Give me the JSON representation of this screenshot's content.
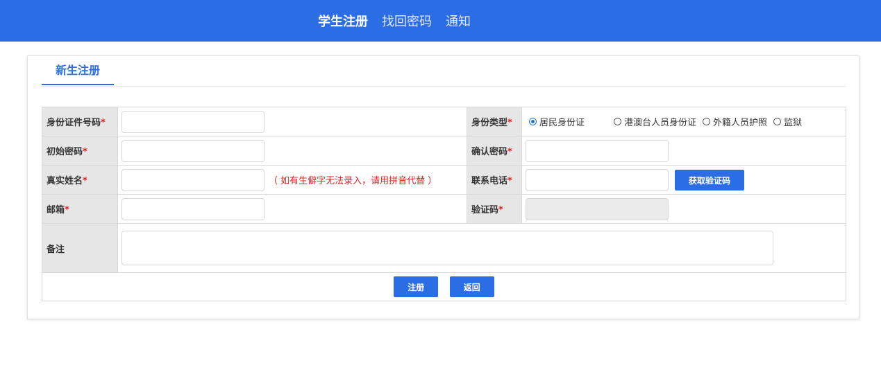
{
  "nav": {
    "items": [
      {
        "label": "学生注册",
        "active": true
      },
      {
        "label": "找回密码",
        "active": false
      },
      {
        "label": "通知",
        "active": false
      }
    ]
  },
  "card": {
    "tab_label": "新生注册"
  },
  "form": {
    "required_mark": "*",
    "id_number": {
      "label": "身份证件号码",
      "value": ""
    },
    "id_type": {
      "label": "身份类型",
      "options": [
        "居民身份证",
        "港澳台人员身份证",
        "外籍人员护照",
        "监狱"
      ],
      "selected": "居民身份证"
    },
    "initial_password": {
      "label": "初始密码",
      "value": ""
    },
    "confirm_password": {
      "label": "确认密码",
      "value": ""
    },
    "real_name": {
      "label": "真实姓名",
      "value": "",
      "hint": "（ 如有生僻字无法录入，请用拼音代替 ）"
    },
    "phone": {
      "label": "联系电话",
      "value": "",
      "get_code_button": "获取验证码"
    },
    "email": {
      "label": "邮箱",
      "value": ""
    },
    "verify_code": {
      "label": "验证码",
      "value": "",
      "disabled": true
    },
    "remark": {
      "label": "备注",
      "value": ""
    },
    "submit_button": "注册",
    "back_button": "返回"
  },
  "colors": {
    "brand": "#2b6de5",
    "required": "#e02020",
    "label_bg": "#e6e6e6"
  }
}
